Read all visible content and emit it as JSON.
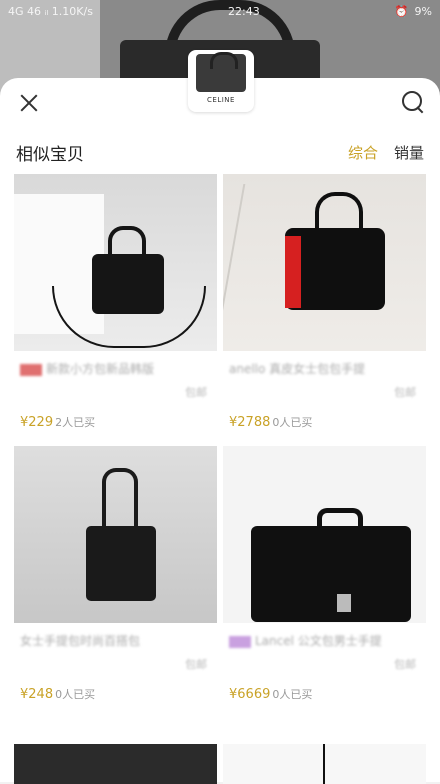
{
  "status_bar": {
    "left": "4G 46 ᵢₗ 1.10K/s",
    "time": "22:43",
    "battery": "9%"
  },
  "thumb": {
    "brand": "CELINE"
  },
  "header": {
    "title": "相似宝贝",
    "sort_active": "综合",
    "sort_sales": "销量"
  },
  "products": [
    {
      "title": "新款小方包新品韩版",
      "meta": "包邮",
      "price": "¥229",
      "sold": "2人已买"
    },
    {
      "title": "anello 真皮女士包包手提",
      "meta": "包邮",
      "price": "¥2788",
      "sold": "0人已买"
    },
    {
      "title": "女士手提包时尚百搭包",
      "meta": "包邮",
      "price": "¥248",
      "sold": "0人已买"
    },
    {
      "title": "Lancel 公文包男士手提",
      "meta": "包邮",
      "price": "¥6669",
      "sold": "0人已买"
    }
  ],
  "colors": {
    "accent": "#c9a227",
    "price": "#c9a227"
  }
}
